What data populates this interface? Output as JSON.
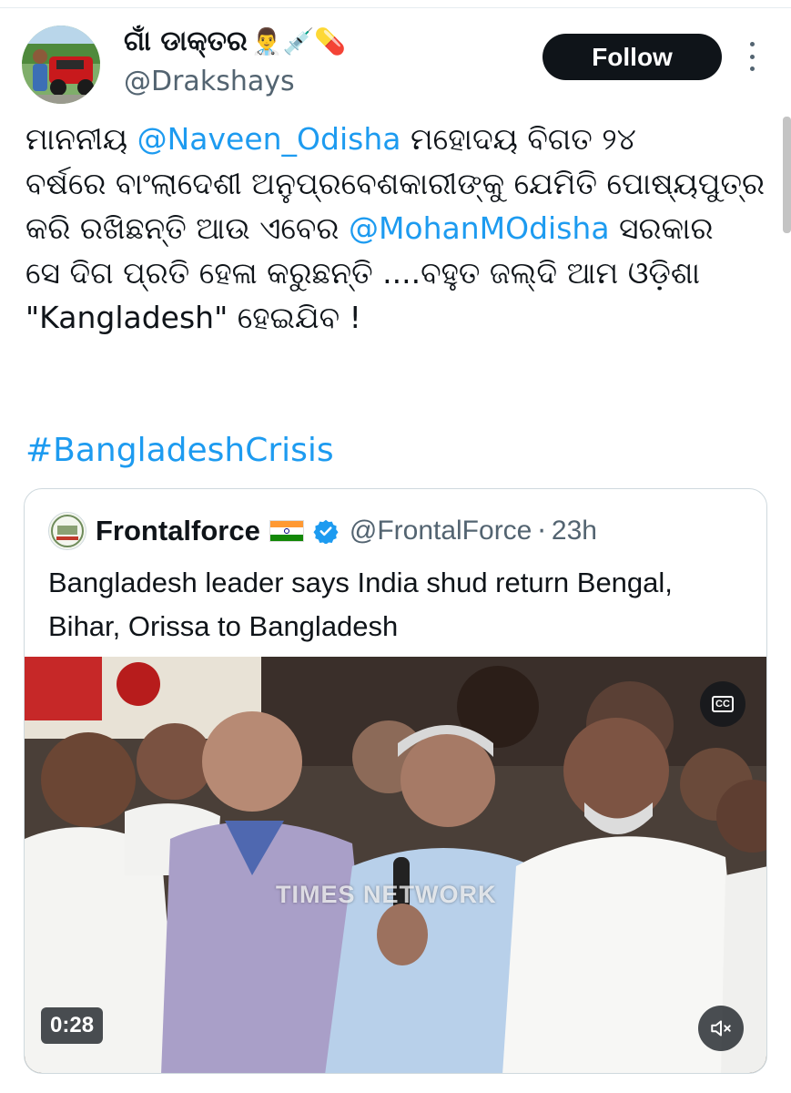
{
  "author": {
    "display_name": "ଗାଁ ଡାକ୍ତର",
    "name_emojis": "👨‍⚕️💉💊",
    "handle": "@Drakshays"
  },
  "follow_label": "Follow",
  "tweet": {
    "segments": [
      [
        "ମାନନୀୟ ",
        "@Naveen_Odisha",
        " ମହୋଦୟ ବିଗତ ୨୪"
      ],
      [
        "ବର୍ଷରେ ବାଂଲାଦେଶୀ ଅନୁପ୍ରବେଶକାରୀଙ୍କୁ ଯେମିତି ପୋଷ୍ୟପୁତ୍ର"
      ],
      [
        "କରି ରଖିଛନ୍ତି ଆଉ ଏବେର ",
        "@MohanMOdisha",
        " ସରକାର"
      ],
      [
        "ସେ ଦିଗ ପ୍ରତି ହେଳା କରୁଛନ୍ତି ....ବହୁତ ଜଲ୍ଦି ଆମ ଓଡ଼ିଶା"
      ],
      [
        "\"Kangladesh\" ହେଇଯିବ !"
      ]
    ],
    "line1_pre": "ମାନନୀୟ ",
    "mention1": "@Naveen_Odisha",
    "line1_post": " ମହୋଦୟ ବିଗତ ୨୪",
    "line2": "ବର୍ଷରେ ବାଂଲାଦେଶୀ ଅନୁପ୍ରବେଶକାରୀଙ୍କୁ ଯେମିତି ପୋଷ୍ୟପୁତ୍ର",
    "line3_pre": "କରି ରଖିଛନ୍ତି ଆଉ ଏବେର ",
    "mention2": "@MohanMOdisha",
    "line3_post": " ସରକାର",
    "line4": "ସେ ଦିଗ ପ୍ରତି ହେଳା କରୁଛନ୍ତି ....ବହୁତ ଜଲ୍ଦି ଆମ ଓଡ଼ିଶା",
    "line5": "\"Kangladesh\" ହେଇଯିବ !",
    "hashtag": "#BangladeshCrisis"
  },
  "quote": {
    "name": "Frontalforce",
    "handle": "@FrontalForce",
    "separator": "·",
    "time": "23h",
    "text_line1": "Bangladesh leader says India shud return Bengal,",
    "text_line2": "Bihar, Orissa to Bangladesh",
    "video": {
      "watermark": "TIMES NETWORK",
      "duration": "0:28",
      "cc_label": "CC",
      "muted": true
    }
  },
  "colors": {
    "link": "#1d9bf0",
    "text": "#0f1419",
    "secondary": "#536471",
    "follow_bg": "#0f1419",
    "verified": "#1d9bf0"
  },
  "icons": [
    "more-vertical-icon",
    "verified-badge-icon",
    "india-flag-icon",
    "closed-captions-icon",
    "volume-muted-icon"
  ]
}
